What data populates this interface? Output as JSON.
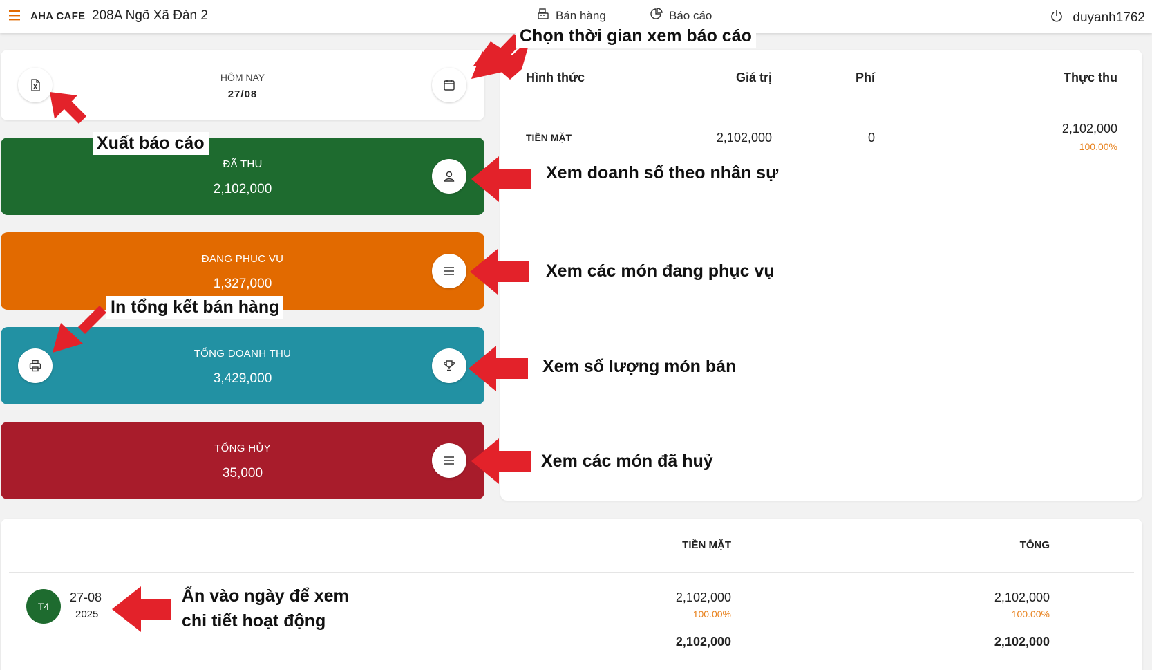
{
  "header": {
    "brand": "AHA CAFE",
    "address": "208A Ngõ Xã Đàn 2",
    "tabs": [
      {
        "label": "Bán hàng",
        "icon": "cash-register-icon"
      },
      {
        "label": "Báo cáo",
        "icon": "pie-chart-icon"
      }
    ],
    "username": "duyanh1762"
  },
  "today": {
    "title": "HÔM NAY",
    "date": "27/08"
  },
  "stats": [
    {
      "title": "ĐÃ THU",
      "value": "2,102,000",
      "color": "#1e6b2f",
      "icon": "user-icon"
    },
    {
      "title": "ĐANG PHỤC VỤ",
      "value": "1,327,000",
      "color": "#e26a00",
      "icon": "list-icon"
    },
    {
      "title": "TỔNG DOANH THU",
      "value": "3,429,000",
      "color": "#2291a3",
      "icon": "trophy-icon"
    },
    {
      "title": "TỔNG HỦY",
      "value": "35,000",
      "color": "#a81c2b",
      "icon": "list-icon"
    }
  ],
  "payments": {
    "headers": {
      "method": "Hình thức",
      "value": "Giá trị",
      "fee": "Phí",
      "net": "Thực thu"
    },
    "rows": [
      {
        "method": "TIỀN MẶT",
        "value": "2,102,000",
        "fee": "0",
        "net": "2,102,000",
        "net_pct": "100.00%"
      }
    ]
  },
  "daily": {
    "headers": {
      "cash": "TIỀN MẶT",
      "total": "TỔNG"
    },
    "rows": [
      {
        "weekday": "T4",
        "day": "27-08",
        "year": "2025",
        "cash": "2,102,000",
        "cash_pct": "100.00%",
        "total": "2,102,000",
        "total_pct": "100.00%"
      }
    ],
    "totals": {
      "cash": "2,102,000",
      "total": "2,102,000"
    }
  },
  "annotations": {
    "time": "Chọn thời gian xem báo cáo",
    "export": "Xuất báo cáo",
    "staff": "Xem doanh số theo nhân sự",
    "serving": "Xem các món đang phục vụ",
    "print": "In tổng kết bán hàng",
    "sold": "Xem số lượng món bán",
    "cancelled": "Xem các món đã huỷ",
    "day_line1": "Ấn vào ngày để xem",
    "day_line2": "chi tiết hoạt động"
  },
  "colors": {
    "accent": "#e26a00",
    "arrow": "#e3222a"
  }
}
